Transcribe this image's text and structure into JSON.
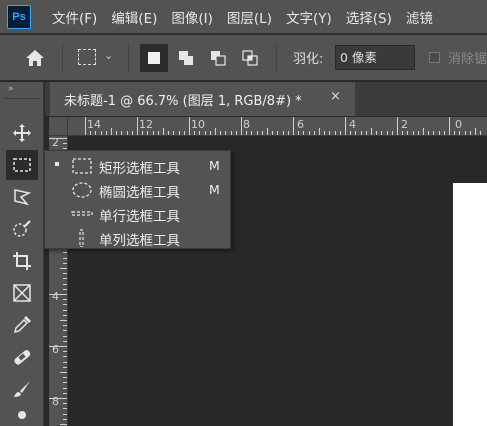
{
  "app": {
    "logo_text": "Ps"
  },
  "menu": [
    "文件(F)",
    "编辑(E)",
    "图像(I)",
    "图层(L)",
    "文字(Y)",
    "选择(S)",
    "滤镜"
  ],
  "options": {
    "feather_label": "羽化:",
    "feather_value": "0 像素",
    "antialias_label": "消除锯齿"
  },
  "document": {
    "title": "未标题-1 @ 66.7% (图层 1, RGB/8#) *",
    "close": "×"
  },
  "ruler_top": [
    "14",
    "12",
    "10",
    "8",
    "6",
    "4",
    "2",
    "0"
  ],
  "ruler_left": [
    "2",
    "4",
    "6",
    "8"
  ],
  "toolbar": {
    "grip": "»"
  },
  "flyout": {
    "items": [
      {
        "label": "矩形选框工具",
        "shortcut": "M",
        "selected": true,
        "icon": "rect-marquee-icon"
      },
      {
        "label": "椭圆选框工具",
        "shortcut": "M",
        "selected": false,
        "icon": "ellipse-marquee-icon"
      },
      {
        "label": "单行选框工具",
        "shortcut": "",
        "selected": false,
        "icon": "single-row-marquee-icon"
      },
      {
        "label": "单列选框工具",
        "shortcut": "",
        "selected": false,
        "icon": "single-column-marquee-icon"
      }
    ]
  },
  "colors": {
    "panel": "#535353",
    "canvas_bg": "#282828",
    "accent": "#31a8ff"
  }
}
